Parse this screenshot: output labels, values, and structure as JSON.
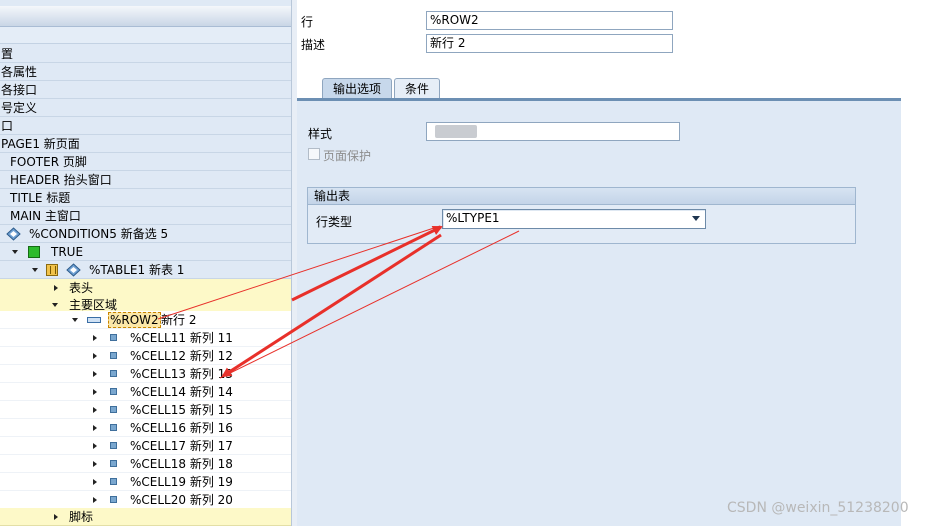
{
  "tree": {
    "items": [
      {
        "label": "置"
      },
      {
        "label": "各属性"
      },
      {
        "label": "各接口"
      },
      {
        "label": "号定义"
      },
      {
        "label": "口"
      },
      {
        "label": "PAGE1 新页面"
      },
      {
        "label": "FOOTER 页脚"
      },
      {
        "label": "HEADER 抬头窗口"
      },
      {
        "label": "TITLE 标题"
      },
      {
        "label": "MAIN 主窗口"
      },
      {
        "label": "%CONDITION5 新备选 5"
      },
      {
        "label": "TRUE"
      },
      {
        "label": "%TABLE1 新表 1"
      },
      {
        "label": "表头"
      },
      {
        "label": "主要区域"
      },
      {
        "name": "%ROW2",
        "desc": "新行 2"
      },
      {
        "label": "%CELL11 新列 11"
      },
      {
        "label": "%CELL12 新列 12"
      },
      {
        "label": "%CELL13 新列 13"
      },
      {
        "label": "%CELL14 新列 14"
      },
      {
        "label": "%CELL15 新列 15"
      },
      {
        "label": "%CELL16 新列 16"
      },
      {
        "label": "%CELL17 新列 17"
      },
      {
        "label": "%CELL18 新列 18"
      },
      {
        "label": "%CELL19 新列 19"
      },
      {
        "label": "%CELL20 新列 20"
      },
      {
        "label": "脚标"
      }
    ]
  },
  "form": {
    "row_label": "行",
    "row_value": "%ROW2",
    "desc_label": "描述",
    "desc_value": "新行 2",
    "tabs": [
      {
        "label": "输出选项"
      },
      {
        "label": "条件"
      }
    ],
    "style_label": "样式",
    "page_protect_label": "页面保护",
    "group_title": "输出表",
    "line_type_label": "行类型",
    "line_type_value": "%LTYPE1"
  },
  "watermark": "CSDN @weixin_51238200",
  "colors": {
    "annotation_arrow": "#e8302a",
    "highlight_row": "#fdf9c8",
    "panel": "#dfe9f5"
  }
}
